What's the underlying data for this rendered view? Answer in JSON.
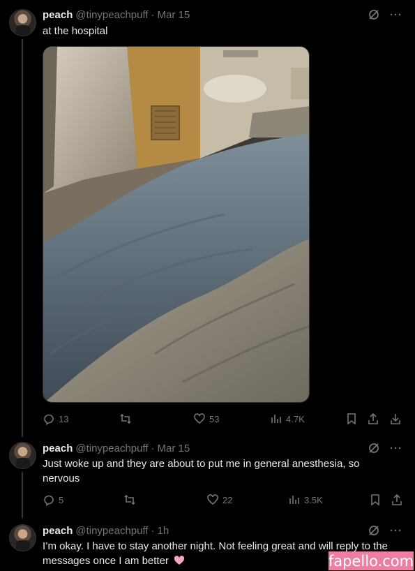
{
  "colors": {
    "background": "#000000",
    "text": "#e7e9ea",
    "muted": "#71767b",
    "watermark_bg": "#ef7ea5"
  },
  "tweets": [
    {
      "name": "peach",
      "handle": "@tinypeachpuff",
      "separator": "·",
      "date": "Mar 15",
      "text": "at the hospital",
      "media": "hospital-bed-photo",
      "replies": "13",
      "likes": "53",
      "views": "4.7K"
    },
    {
      "name": "peach",
      "handle": "@tinypeachpuff",
      "separator": "·",
      "date": "Mar 15",
      "text": "Just woke up and they are about to put me in general anesthesia, so nervous",
      "replies": "5",
      "likes": "22",
      "views": "3.5K"
    },
    {
      "name": "peach",
      "handle": "@tinypeachpuff",
      "separator": "·",
      "date": "1h",
      "text": "I’m okay. I have to stay another night. Not feeling great and will reply to the messages once I am better",
      "emoji": "pink-heart"
    }
  ],
  "more_label": "···",
  "watermark": "fapello.com"
}
